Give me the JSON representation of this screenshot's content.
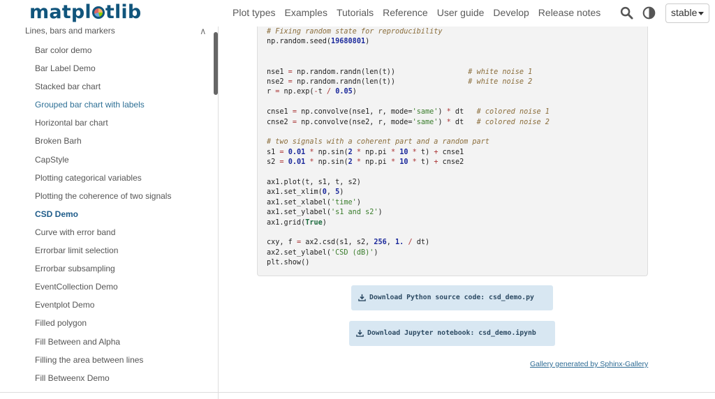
{
  "header": {
    "logo_text_a": "matpl",
    "logo_text_b": "tlib",
    "nav": [
      "Plot types",
      "Examples",
      "Tutorials",
      "Reference",
      "User guide",
      "Develop",
      "Release notes"
    ],
    "version": "stable",
    "icons": {
      "search": "search-icon",
      "theme": "theme-toggle-icon",
      "version_caret": "caret-down-icon"
    }
  },
  "sidebar": {
    "heading": "Lines, bars and markers",
    "collapse_icon": "chevron-up-icon",
    "items": [
      {
        "label": "Bar color demo",
        "state": "normal"
      },
      {
        "label": "Bar Label Demo",
        "state": "normal"
      },
      {
        "label": "Stacked bar chart",
        "state": "normal"
      },
      {
        "label": "Grouped bar chart with labels",
        "state": "visited"
      },
      {
        "label": "Horizontal bar chart",
        "state": "normal"
      },
      {
        "label": "Broken Barh",
        "state": "normal"
      },
      {
        "label": "CapStyle",
        "state": "normal"
      },
      {
        "label": "Plotting categorical variables",
        "state": "normal"
      },
      {
        "label": "Plotting the coherence of two signals",
        "state": "normal"
      },
      {
        "label": "CSD Demo",
        "state": "active"
      },
      {
        "label": "Curve with error band",
        "state": "normal"
      },
      {
        "label": "Errorbar limit selection",
        "state": "normal"
      },
      {
        "label": "Errorbar subsampling",
        "state": "normal"
      },
      {
        "label": "EventCollection Demo",
        "state": "normal"
      },
      {
        "label": "Eventplot Demo",
        "state": "normal"
      },
      {
        "label": "Filled polygon",
        "state": "normal"
      },
      {
        "label": "Fill Between and Alpha",
        "state": "normal"
      },
      {
        "label": "Filling the area between lines",
        "state": "normal"
      },
      {
        "label": "Fill Betweenx Demo",
        "state": "normal"
      }
    ]
  },
  "code": {
    "lines": [
      {
        "row": 0,
        "tokens": [
          {
            "t": "c",
            "v": "# Fixing random state for reproducibility"
          }
        ]
      },
      {
        "row": 1,
        "tokens": [
          {
            "t": "p",
            "v": "np.random.seed("
          },
          {
            "t": "n",
            "v": "19680801"
          },
          {
            "t": "p",
            "v": ")"
          }
        ]
      },
      {
        "row": 4,
        "tokens": [
          {
            "t": "p",
            "v": "nse1 "
          },
          {
            "t": "o",
            "v": "="
          },
          {
            "t": "p",
            "v": " np.random.randn(len(t))                 "
          },
          {
            "t": "c",
            "v": "# white noise 1"
          }
        ]
      },
      {
        "row": 5,
        "tokens": [
          {
            "t": "p",
            "v": "nse2 "
          },
          {
            "t": "o",
            "v": "="
          },
          {
            "t": "p",
            "v": " np.random.randn(len(t))                 "
          },
          {
            "t": "c",
            "v": "# white noise 2"
          }
        ]
      },
      {
        "row": 6,
        "tokens": [
          {
            "t": "p",
            "v": "r "
          },
          {
            "t": "o",
            "v": "="
          },
          {
            "t": "p",
            "v": " np.exp("
          },
          {
            "t": "o",
            "v": "-"
          },
          {
            "t": "p",
            "v": "t "
          },
          {
            "t": "o",
            "v": "/"
          },
          {
            "t": "p",
            "v": " "
          },
          {
            "t": "n",
            "v": "0.05"
          },
          {
            "t": "p",
            "v": ")"
          }
        ]
      },
      {
        "row": 8,
        "tokens": [
          {
            "t": "p",
            "v": "cnse1 "
          },
          {
            "t": "o",
            "v": "="
          },
          {
            "t": "p",
            "v": " np.convolve(nse1, r, mode="
          },
          {
            "t": "s",
            "v": "'same'"
          },
          {
            "t": "p",
            "v": ") "
          },
          {
            "t": "o",
            "v": "*"
          },
          {
            "t": "p",
            "v": " dt   "
          },
          {
            "t": "c",
            "v": "# colored noise 1"
          }
        ]
      },
      {
        "row": 9,
        "tokens": [
          {
            "t": "p",
            "v": "cnse2 "
          },
          {
            "t": "o",
            "v": "="
          },
          {
            "t": "p",
            "v": " np.convolve(nse2, r, mode="
          },
          {
            "t": "s",
            "v": "'same'"
          },
          {
            "t": "p",
            "v": ") "
          },
          {
            "t": "o",
            "v": "*"
          },
          {
            "t": "p",
            "v": " dt   "
          },
          {
            "t": "c",
            "v": "# colored noise 2"
          }
        ]
      },
      {
        "row": 11,
        "tokens": [
          {
            "t": "c",
            "v": "# two signals with a coherent part and a random part"
          }
        ]
      },
      {
        "row": 12,
        "tokens": [
          {
            "t": "p",
            "v": "s1 "
          },
          {
            "t": "o",
            "v": "="
          },
          {
            "t": "p",
            "v": " "
          },
          {
            "t": "n",
            "v": "0.01"
          },
          {
            "t": "p",
            "v": " "
          },
          {
            "t": "o",
            "v": "*"
          },
          {
            "t": "p",
            "v": " np.sin("
          },
          {
            "t": "n",
            "v": "2"
          },
          {
            "t": "p",
            "v": " "
          },
          {
            "t": "o",
            "v": "*"
          },
          {
            "t": "p",
            "v": " np.pi "
          },
          {
            "t": "o",
            "v": "*"
          },
          {
            "t": "p",
            "v": " "
          },
          {
            "t": "n",
            "v": "10"
          },
          {
            "t": "p",
            "v": " "
          },
          {
            "t": "o",
            "v": "*"
          },
          {
            "t": "p",
            "v": " t) "
          },
          {
            "t": "o",
            "v": "+"
          },
          {
            "t": "p",
            "v": " cnse1"
          }
        ]
      },
      {
        "row": 13,
        "tokens": [
          {
            "t": "p",
            "v": "s2 "
          },
          {
            "t": "o",
            "v": "="
          },
          {
            "t": "p",
            "v": " "
          },
          {
            "t": "n",
            "v": "0.01"
          },
          {
            "t": "p",
            "v": " "
          },
          {
            "t": "o",
            "v": "*"
          },
          {
            "t": "p",
            "v": " np.sin("
          },
          {
            "t": "n",
            "v": "2"
          },
          {
            "t": "p",
            "v": " "
          },
          {
            "t": "o",
            "v": "*"
          },
          {
            "t": "p",
            "v": " np.pi "
          },
          {
            "t": "o",
            "v": "*"
          },
          {
            "t": "p",
            "v": " "
          },
          {
            "t": "n",
            "v": "10"
          },
          {
            "t": "p",
            "v": " "
          },
          {
            "t": "o",
            "v": "*"
          },
          {
            "t": "p",
            "v": " t) "
          },
          {
            "t": "o",
            "v": "+"
          },
          {
            "t": "p",
            "v": " cnse2"
          }
        ]
      },
      {
        "row": 15,
        "tokens": [
          {
            "t": "p",
            "v": "ax1.plot(t, s1, t, s2)"
          }
        ]
      },
      {
        "row": 16,
        "tokens": [
          {
            "t": "p",
            "v": "ax1.set_xlim("
          },
          {
            "t": "n",
            "v": "0"
          },
          {
            "t": "p",
            "v": ", "
          },
          {
            "t": "n",
            "v": "5"
          },
          {
            "t": "p",
            "v": ")"
          }
        ]
      },
      {
        "row": 17,
        "tokens": [
          {
            "t": "p",
            "v": "ax1.set_xlabel("
          },
          {
            "t": "s",
            "v": "'time'"
          },
          {
            "t": "p",
            "v": ")"
          }
        ]
      },
      {
        "row": 18,
        "tokens": [
          {
            "t": "p",
            "v": "ax1.set_ylabel("
          },
          {
            "t": "s",
            "v": "'s1 and s2'"
          },
          {
            "t": "p",
            "v": ")"
          }
        ]
      },
      {
        "row": 19,
        "tokens": [
          {
            "t": "p",
            "v": "ax1.grid("
          },
          {
            "t": "k",
            "v": "True"
          },
          {
            "t": "p",
            "v": ")"
          }
        ]
      },
      {
        "row": 21,
        "tokens": [
          {
            "t": "p",
            "v": "cxy, f "
          },
          {
            "t": "o",
            "v": "="
          },
          {
            "t": "p",
            "v": " ax2.csd(s1, s2, "
          },
          {
            "t": "n",
            "v": "256"
          },
          {
            "t": "p",
            "v": ", "
          },
          {
            "t": "n",
            "v": "1."
          },
          {
            "t": "p",
            "v": " "
          },
          {
            "t": "o",
            "v": "/"
          },
          {
            "t": "p",
            "v": " dt)"
          }
        ]
      },
      {
        "row": 22,
        "tokens": [
          {
            "t": "p",
            "v": "ax2.set_ylabel("
          },
          {
            "t": "s",
            "v": "'CSD (dB)'"
          },
          {
            "t": "p",
            "v": ")"
          }
        ]
      },
      {
        "row": 23,
        "tokens": [
          {
            "t": "p",
            "v": "plt.show()"
          }
        ]
      }
    ]
  },
  "downloads": {
    "python_label": "Download Python source code: csd_demo.py",
    "notebook_label": "Download Jupyter notebook: csd_demo.ipynb",
    "icon": "download-icon"
  },
  "footer_note": "Gallery generated by Sphinx-Gallery",
  "colors": {
    "brand": "#11557c",
    "code_bg": "#f3f3f3",
    "download_bg": "#d8e7f2",
    "link": "#2c6a93"
  }
}
